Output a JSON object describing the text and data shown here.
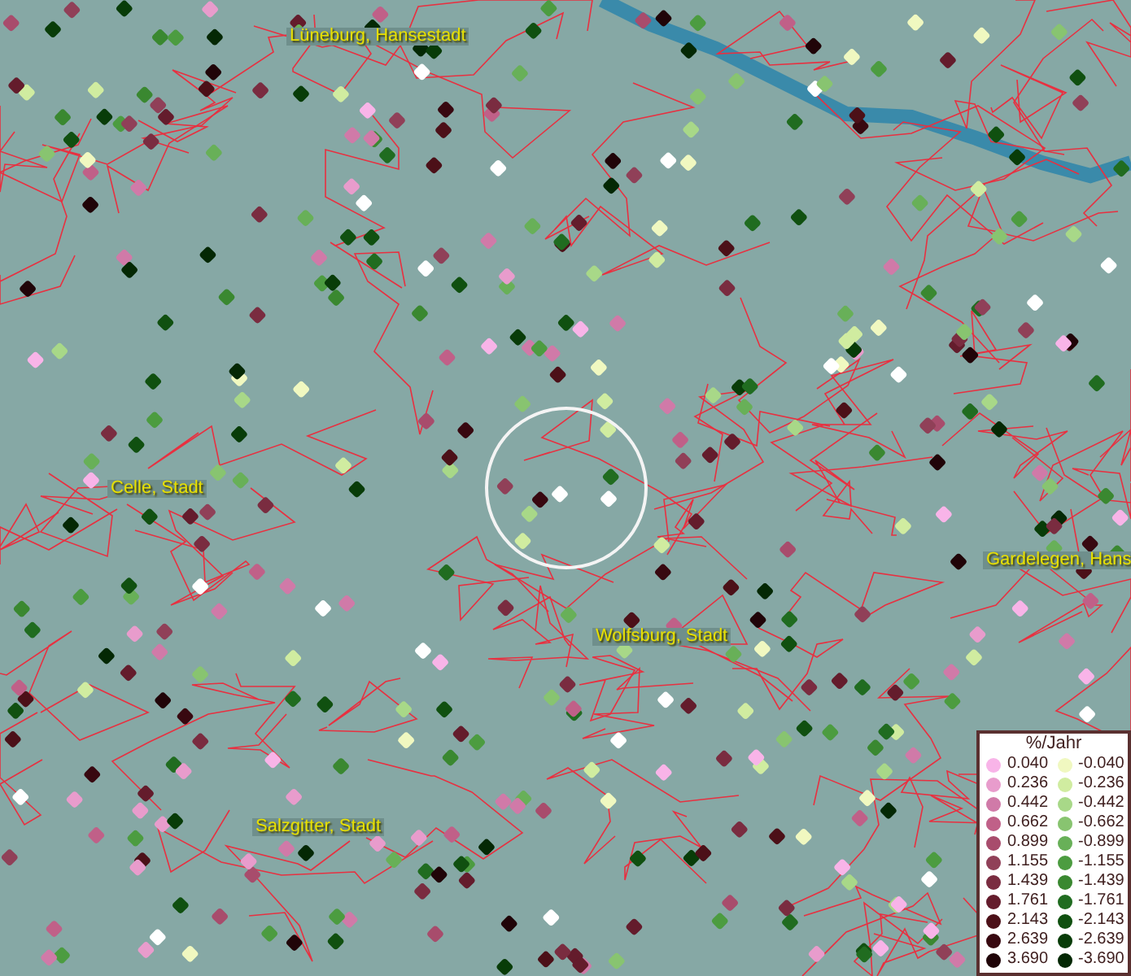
{
  "map": {
    "places": [
      {
        "kind": "city",
        "label": "Lüneburg, Hansestadt"
      },
      {
        "kind": "city",
        "label": "Celle, Stadt"
      },
      {
        "kind": "city",
        "label": "Gardelegen, Hans"
      },
      {
        "kind": "city",
        "label": "Wolfsburg, Stadt"
      },
      {
        "kind": "city",
        "label": "Salzgitter, Stadt"
      }
    ]
  },
  "legend": {
    "title": "%/Jahr",
    "positive": [
      {
        "label": "0.040",
        "color": "#f8b4e8"
      },
      {
        "label": "0.236",
        "color": "#e89ccc"
      },
      {
        "label": "0.442",
        "color": "#d07aa8"
      },
      {
        "label": "0.662",
        "color": "#c06088"
      },
      {
        "label": "0.899",
        "color": "#a84c6c"
      },
      {
        "label": "1.155",
        "color": "#904058"
      },
      {
        "label": "1.439",
        "color": "#7a2c40"
      },
      {
        "label": "1.761",
        "color": "#641c2c"
      },
      {
        "label": "2.143",
        "color": "#4c1018"
      },
      {
        "label": "2.639",
        "color": "#380810"
      },
      {
        "label": "3.690",
        "color": "#200408"
      }
    ],
    "negative": [
      {
        "label": "-0.040",
        "color": "#f0f8c0"
      },
      {
        "label": "-0.236",
        "color": "#d0eca0"
      },
      {
        "label": "-0.442",
        "color": "#a8d888"
      },
      {
        "label": "-0.662",
        "color": "#88c470"
      },
      {
        "label": "-0.899",
        "color": "#68b058"
      },
      {
        "label": "-1.155",
        "color": "#4c9c40"
      },
      {
        "label": "-1.439",
        "color": "#3a8830"
      },
      {
        "label": "-1.761",
        "color": "#206c20"
      },
      {
        "label": "-2.143",
        "color": "#105010"
      },
      {
        "label": "-2.639",
        "color": "#083c08"
      },
      {
        "label": "-3.690",
        "color": "#042804"
      }
    ]
  }
}
